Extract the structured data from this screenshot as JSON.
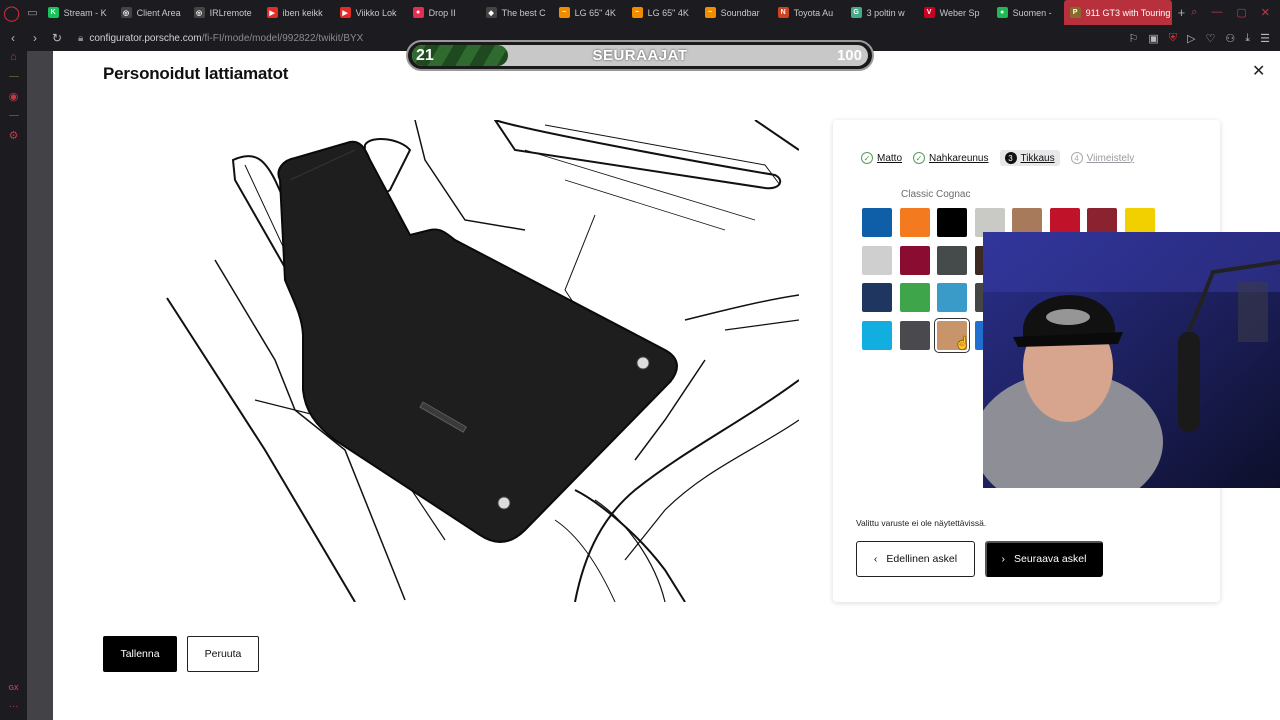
{
  "browser": {
    "tabs": [
      {
        "label": "Stream - K",
        "fav_color": "#19c35a",
        "fav_glyph": "K"
      },
      {
        "label": "Client Area",
        "fav_color": "#444",
        "fav_glyph": "◎"
      },
      {
        "label": "IRLremote",
        "fav_color": "#444",
        "fav_glyph": "◎"
      },
      {
        "label": "iben keikk",
        "fav_color": "#e52d27",
        "fav_glyph": "▶"
      },
      {
        "label": "Viikko Lok",
        "fav_color": "#e52d27",
        "fav_glyph": "▶"
      },
      {
        "label": "Drop II",
        "fav_color": "#e52d4f",
        "fav_glyph": "●"
      },
      {
        "label": "The best C",
        "fav_color": "#444",
        "fav_glyph": "◆"
      },
      {
        "label": "LG 65\" 4K",
        "fav_color": "#f08c00",
        "fav_glyph": "~"
      },
      {
        "label": "LG 65\" 4K",
        "fav_color": "#f08c00",
        "fav_glyph": "~"
      },
      {
        "label": "Soundbar",
        "fav_color": "#f08c00",
        "fav_glyph": "~"
      },
      {
        "label": "Toyota Au",
        "fav_color": "#c42",
        "fav_glyph": "N"
      },
      {
        "label": "3 poltin w",
        "fav_color": "#4a8",
        "fav_glyph": "G"
      },
      {
        "label": "Weber Sp",
        "fav_color": "#c02",
        "fav_glyph": "V"
      },
      {
        "label": "Suomen -",
        "fav_color": "#1db954",
        "fav_glyph": "●"
      }
    ],
    "active_tab": {
      "label": "911 GT3 with Touring",
      "fav_color": "#8a6a2a",
      "fav_glyph": "P"
    },
    "url_host": "configurator.porsche.com",
    "url_path": "/fi-FI/mode/model/992822/twikit/BYX"
  },
  "overlay": {
    "current": "21",
    "title": "SEURAAJAT",
    "goal": "100",
    "progress": 0.21
  },
  "page": {
    "title": "Personoidut lattiamatot",
    "save_label": "Tallenna",
    "cancel_label": "Peruuta"
  },
  "panel": {
    "steps": [
      {
        "label": "Matto",
        "state": "done"
      },
      {
        "label": "Nahkareunus",
        "state": "done"
      },
      {
        "label": "Tikkaus",
        "state": "active",
        "num": "3"
      },
      {
        "label": "Viimeistely",
        "state": "disabled",
        "num": "4"
      }
    ],
    "selected_color": "Classic Cognac",
    "swatches": [
      [
        "#0f5ea8",
        "#f47a20",
        "#000000",
        "#c9c9c6",
        "#a87a5c",
        "#c01228",
        "#8a2230",
        "#f2d000"
      ],
      [
        "#cfcfcf",
        "#8a0c30",
        "#454a4a",
        "#3a2a22"
      ],
      [
        "#1e3660",
        "#3fa54a",
        "#3a9ac8",
        "#454545"
      ],
      [
        "#12aee0",
        "#4a4a4e",
        "#c8946a",
        "#1e6fd0"
      ]
    ],
    "selected_swatch": [
      3,
      2
    ],
    "info": "Valittu varuste ei ole näytettävissä.",
    "prev_label": "Edellinen askel",
    "next_label": "Seuraava askel"
  }
}
